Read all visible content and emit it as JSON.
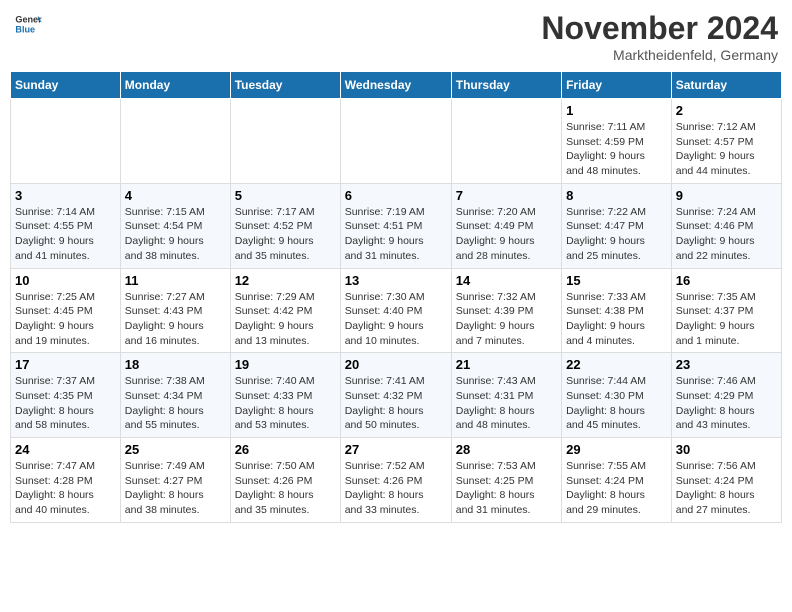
{
  "header": {
    "logo_line1": "General",
    "logo_line2": "Blue",
    "month_title": "November 2024",
    "location": "Marktheidenfeld, Germany"
  },
  "weekdays": [
    "Sunday",
    "Monday",
    "Tuesday",
    "Wednesday",
    "Thursday",
    "Friday",
    "Saturday"
  ],
  "weeks": [
    [
      {
        "day": "",
        "info": ""
      },
      {
        "day": "",
        "info": ""
      },
      {
        "day": "",
        "info": ""
      },
      {
        "day": "",
        "info": ""
      },
      {
        "day": "",
        "info": ""
      },
      {
        "day": "1",
        "info": "Sunrise: 7:11 AM\nSunset: 4:59 PM\nDaylight: 9 hours\nand 48 minutes."
      },
      {
        "day": "2",
        "info": "Sunrise: 7:12 AM\nSunset: 4:57 PM\nDaylight: 9 hours\nand 44 minutes."
      }
    ],
    [
      {
        "day": "3",
        "info": "Sunrise: 7:14 AM\nSunset: 4:55 PM\nDaylight: 9 hours\nand 41 minutes."
      },
      {
        "day": "4",
        "info": "Sunrise: 7:15 AM\nSunset: 4:54 PM\nDaylight: 9 hours\nand 38 minutes."
      },
      {
        "day": "5",
        "info": "Sunrise: 7:17 AM\nSunset: 4:52 PM\nDaylight: 9 hours\nand 35 minutes."
      },
      {
        "day": "6",
        "info": "Sunrise: 7:19 AM\nSunset: 4:51 PM\nDaylight: 9 hours\nand 31 minutes."
      },
      {
        "day": "7",
        "info": "Sunrise: 7:20 AM\nSunset: 4:49 PM\nDaylight: 9 hours\nand 28 minutes."
      },
      {
        "day": "8",
        "info": "Sunrise: 7:22 AM\nSunset: 4:47 PM\nDaylight: 9 hours\nand 25 minutes."
      },
      {
        "day": "9",
        "info": "Sunrise: 7:24 AM\nSunset: 4:46 PM\nDaylight: 9 hours\nand 22 minutes."
      }
    ],
    [
      {
        "day": "10",
        "info": "Sunrise: 7:25 AM\nSunset: 4:45 PM\nDaylight: 9 hours\nand 19 minutes."
      },
      {
        "day": "11",
        "info": "Sunrise: 7:27 AM\nSunset: 4:43 PM\nDaylight: 9 hours\nand 16 minutes."
      },
      {
        "day": "12",
        "info": "Sunrise: 7:29 AM\nSunset: 4:42 PM\nDaylight: 9 hours\nand 13 minutes."
      },
      {
        "day": "13",
        "info": "Sunrise: 7:30 AM\nSunset: 4:40 PM\nDaylight: 9 hours\nand 10 minutes."
      },
      {
        "day": "14",
        "info": "Sunrise: 7:32 AM\nSunset: 4:39 PM\nDaylight: 9 hours\nand 7 minutes."
      },
      {
        "day": "15",
        "info": "Sunrise: 7:33 AM\nSunset: 4:38 PM\nDaylight: 9 hours\nand 4 minutes."
      },
      {
        "day": "16",
        "info": "Sunrise: 7:35 AM\nSunset: 4:37 PM\nDaylight: 9 hours\nand 1 minute."
      }
    ],
    [
      {
        "day": "17",
        "info": "Sunrise: 7:37 AM\nSunset: 4:35 PM\nDaylight: 8 hours\nand 58 minutes."
      },
      {
        "day": "18",
        "info": "Sunrise: 7:38 AM\nSunset: 4:34 PM\nDaylight: 8 hours\nand 55 minutes."
      },
      {
        "day": "19",
        "info": "Sunrise: 7:40 AM\nSunset: 4:33 PM\nDaylight: 8 hours\nand 53 minutes."
      },
      {
        "day": "20",
        "info": "Sunrise: 7:41 AM\nSunset: 4:32 PM\nDaylight: 8 hours\nand 50 minutes."
      },
      {
        "day": "21",
        "info": "Sunrise: 7:43 AM\nSunset: 4:31 PM\nDaylight: 8 hours\nand 48 minutes."
      },
      {
        "day": "22",
        "info": "Sunrise: 7:44 AM\nSunset: 4:30 PM\nDaylight: 8 hours\nand 45 minutes."
      },
      {
        "day": "23",
        "info": "Sunrise: 7:46 AM\nSunset: 4:29 PM\nDaylight: 8 hours\nand 43 minutes."
      }
    ],
    [
      {
        "day": "24",
        "info": "Sunrise: 7:47 AM\nSunset: 4:28 PM\nDaylight: 8 hours\nand 40 minutes."
      },
      {
        "day": "25",
        "info": "Sunrise: 7:49 AM\nSunset: 4:27 PM\nDaylight: 8 hours\nand 38 minutes."
      },
      {
        "day": "26",
        "info": "Sunrise: 7:50 AM\nSunset: 4:26 PM\nDaylight: 8 hours\nand 35 minutes."
      },
      {
        "day": "27",
        "info": "Sunrise: 7:52 AM\nSunset: 4:26 PM\nDaylight: 8 hours\nand 33 minutes."
      },
      {
        "day": "28",
        "info": "Sunrise: 7:53 AM\nSunset: 4:25 PM\nDaylight: 8 hours\nand 31 minutes."
      },
      {
        "day": "29",
        "info": "Sunrise: 7:55 AM\nSunset: 4:24 PM\nDaylight: 8 hours\nand 29 minutes."
      },
      {
        "day": "30",
        "info": "Sunrise: 7:56 AM\nSunset: 4:24 PM\nDaylight: 8 hours\nand 27 minutes."
      }
    ]
  ]
}
